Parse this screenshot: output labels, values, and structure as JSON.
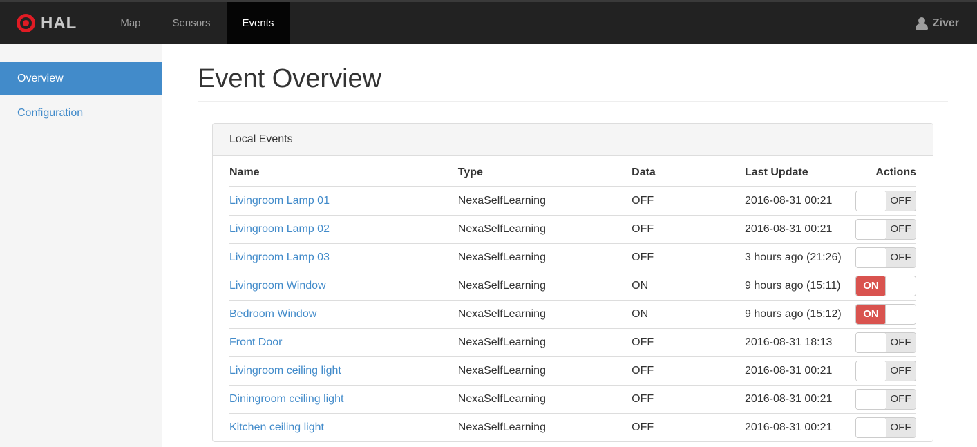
{
  "navbar": {
    "brand": "HAL",
    "items": [
      {
        "label": "Map",
        "active": false
      },
      {
        "label": "Sensors",
        "active": false
      },
      {
        "label": "Events",
        "active": true
      }
    ],
    "user": "Ziver"
  },
  "sidebar": {
    "items": [
      {
        "label": "Overview",
        "active": true
      },
      {
        "label": "Configuration",
        "active": false
      }
    ]
  },
  "main": {
    "title": "Event Overview",
    "panel": {
      "title": "Local Events",
      "table": {
        "columns": [
          "Name",
          "Type",
          "Data",
          "Last Update",
          "Actions"
        ],
        "rows": [
          {
            "name": "Livingroom Lamp 01",
            "type": "NexaSelfLearning",
            "data": "OFF",
            "last_update": "2016-08-31 00:21",
            "toggle": "OFF"
          },
          {
            "name": "Livingroom Lamp 02",
            "type": "NexaSelfLearning",
            "data": "OFF",
            "last_update": "2016-08-31 00:21",
            "toggle": "OFF"
          },
          {
            "name": "Livingroom Lamp 03",
            "type": "NexaSelfLearning",
            "data": "OFF",
            "last_update": "3 hours ago (21:26)",
            "toggle": "OFF"
          },
          {
            "name": "Livingroom Window",
            "type": "NexaSelfLearning",
            "data": "ON",
            "last_update": "9 hours ago (15:11)",
            "toggle": "ON"
          },
          {
            "name": "Bedroom Window",
            "type": "NexaSelfLearning",
            "data": "ON",
            "last_update": "9 hours ago (15:12)",
            "toggle": "ON"
          },
          {
            "name": "Front Door",
            "type": "NexaSelfLearning",
            "data": "OFF",
            "last_update": "2016-08-31 18:13",
            "toggle": "OFF"
          },
          {
            "name": "Livingroom ceiling light",
            "type": "NexaSelfLearning",
            "data": "OFF",
            "last_update": "2016-08-31 00:21",
            "toggle": "OFF"
          },
          {
            "name": "Diningroom ceiling light",
            "type": "NexaSelfLearning",
            "data": "OFF",
            "last_update": "2016-08-31 00:21",
            "toggle": "OFF"
          },
          {
            "name": "Kitchen ceiling light",
            "type": "NexaSelfLearning",
            "data": "OFF",
            "last_update": "2016-08-31 00:21",
            "toggle": "OFF"
          }
        ]
      }
    }
  },
  "colors": {
    "accent_blue": "#428bca",
    "toggle_on_red": "#d9534f",
    "navbar_bg": "#222222",
    "brand_red": "#e01b24",
    "panel_header_bg": "#f5f5f5"
  }
}
